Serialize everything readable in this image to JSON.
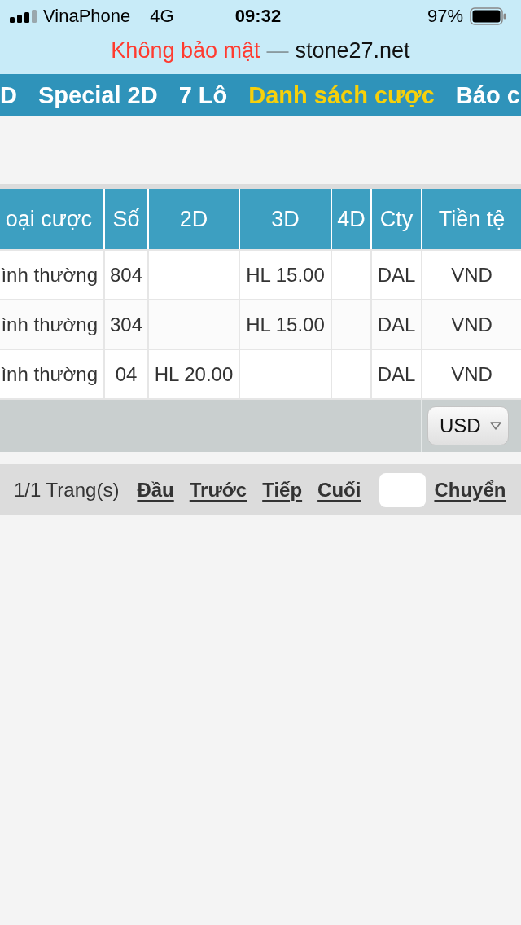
{
  "status_bar": {
    "carrier": "VinaPhone",
    "network": "4G",
    "time": "09:32",
    "battery": "97%"
  },
  "address_bar": {
    "security": "Không bảo mật",
    "separator": "—",
    "domain": "stone27.net"
  },
  "nav": {
    "items": [
      {
        "label": "D",
        "selected": false
      },
      {
        "label": "Special 2D",
        "selected": false
      },
      {
        "label": "7 Lô",
        "selected": false
      },
      {
        "label": "Danh sách cược",
        "selected": true
      },
      {
        "label": "Báo c",
        "selected": false
      }
    ]
  },
  "table": {
    "columns": [
      "oại cược",
      "Số",
      "2D",
      "3D",
      "4D",
      "Cty",
      "Tiền tệ"
    ],
    "rows": [
      {
        "bet_type": "ình thường",
        "number": "804",
        "three_d": "HL 15.00",
        "company": "DAL",
        "currency": "VND"
      },
      {
        "bet_type": "ình thường",
        "number": "304",
        "three_d": "HL 15.00",
        "company": "DAL",
        "currency": "VND"
      },
      {
        "bet_type": "ình thường",
        "number": "04",
        "two_d": "HL 20.00",
        "company": "DAL",
        "currency": "VND"
      }
    ],
    "footer": {
      "currency_select": "USD"
    }
  },
  "pagination": {
    "page_info": "1/1 Trang(s)",
    "links": [
      "Đầu",
      "Trước",
      "Tiếp",
      "Cuối"
    ],
    "go_link": "Chuyển"
  }
}
